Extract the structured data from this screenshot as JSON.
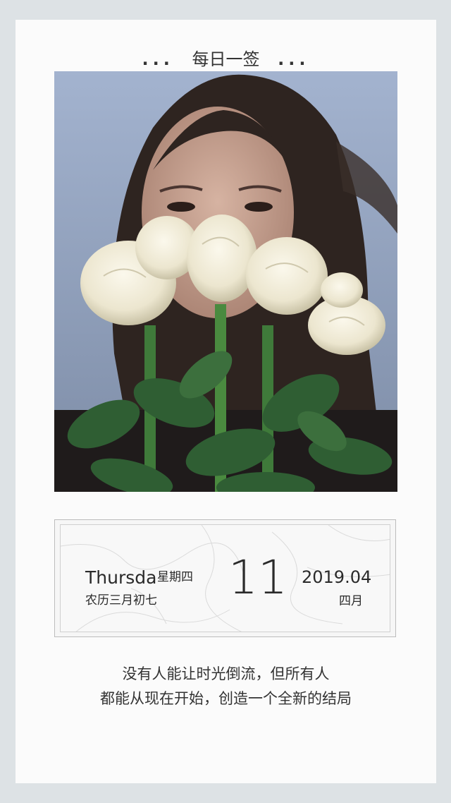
{
  "header": {
    "title": "每日一签",
    "dots_left": "...",
    "dots_right": "..."
  },
  "photo": {
    "subject": "woman holding white roses"
  },
  "date": {
    "weekday_en": "Thursda",
    "weekday_cn": "星期四",
    "lunar": "农历三月初七",
    "day": "11",
    "year_month": "2019.04",
    "month_cn": "四月"
  },
  "quote": {
    "line1": "没有人能让时光倒流，但所有人",
    "line2": "都能从现在开始，创造一个全新的结局"
  }
}
